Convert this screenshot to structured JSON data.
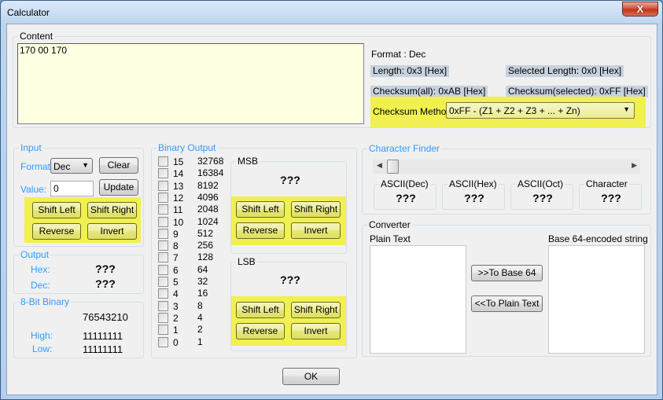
{
  "window": {
    "title": "Calculator",
    "close_label": "X"
  },
  "content": {
    "label": "Content",
    "value": "170 00 170",
    "format": "Format : Dec",
    "length": "Length:  0x3 [Hex]",
    "selected_length": "Selected Length:  0x0 [Hex]",
    "checksum_all": "Checksum(all):  0xAB [Hex]",
    "checksum_selected": "Checksum(selected):  0xFF [Hex]",
    "checksum_method_label": "Checksum Method:",
    "checksum_method_value": "0xFF - (Z1 + Z2 + Z3 + ... + Zn)"
  },
  "input": {
    "label": "Input",
    "format_label": "Format:",
    "format_value": "Dec",
    "value_label": "Value:",
    "value": "0",
    "clear": "Clear",
    "update": "Update",
    "shift_left": "Shift Left",
    "shift_right": "Shift Right",
    "reverse": "Reverse",
    "invert": "Invert"
  },
  "output": {
    "label": "Output",
    "hex_label": "Hex:",
    "hex_value": "???",
    "dec_label": "Dec:",
    "dec_value": "???"
  },
  "binary8": {
    "label": "8-Bit Binary",
    "positions": "76543210",
    "high_label": "High:",
    "high_value": "11111111",
    "low_label": "Low:",
    "low_value": "11111111"
  },
  "binary_output": {
    "label": "Binary Output",
    "bits": [
      {
        "bit": "15",
        "value": "32768",
        "checked": false
      },
      {
        "bit": "14",
        "value": "16384",
        "checked": false
      },
      {
        "bit": "13",
        "value": "8192",
        "checked": false
      },
      {
        "bit": "12",
        "value": "4096",
        "checked": false
      },
      {
        "bit": "11",
        "value": "2048",
        "checked": false
      },
      {
        "bit": "10",
        "value": "1024",
        "checked": false
      },
      {
        "bit": "9",
        "value": "512",
        "checked": false
      },
      {
        "bit": "8",
        "value": "256",
        "checked": false
      },
      {
        "bit": "7",
        "value": "128",
        "checked": false
      },
      {
        "bit": "6",
        "value": "64",
        "checked": false
      },
      {
        "bit": "5",
        "value": "32",
        "checked": false
      },
      {
        "bit": "4",
        "value": "16",
        "checked": false
      },
      {
        "bit": "3",
        "value": "8",
        "checked": false
      },
      {
        "bit": "2",
        "value": "4",
        "checked": false
      },
      {
        "bit": "1",
        "value": "2",
        "checked": false
      },
      {
        "bit": "0",
        "value": "1",
        "checked": false
      }
    ],
    "msb": {
      "label": "MSB",
      "value": "???",
      "shift_left": "Shift Left",
      "shift_right": "Shift Right",
      "reverse": "Reverse",
      "invert": "Invert"
    },
    "lsb": {
      "label": "LSB",
      "value": "???",
      "shift_left": "Shift Left",
      "shift_right": "Shift Right",
      "reverse": "Reverse",
      "invert": "Invert"
    }
  },
  "char_finder": {
    "label": "Character Finder",
    "slider_value": 0,
    "boxes": [
      {
        "label": "ASCII(Dec)",
        "value": "???"
      },
      {
        "label": "ASCII(Hex)",
        "value": "???"
      },
      {
        "label": "ASCII(Oct)",
        "value": "???"
      },
      {
        "label": "Character",
        "value": "???"
      }
    ]
  },
  "converter": {
    "label": "Converter",
    "plain_label": "Plain Text",
    "plain_value": "",
    "base64_label": "Base 64-encoded string",
    "base64_value": "",
    "to_base64": ">>To Base 64",
    "to_plain": "<<To Plain Text"
  },
  "ok_label": "OK",
  "colors": {
    "highlight": "#f0f050",
    "content_bg": "#ffffe1",
    "label_blue": "#3399ff"
  }
}
